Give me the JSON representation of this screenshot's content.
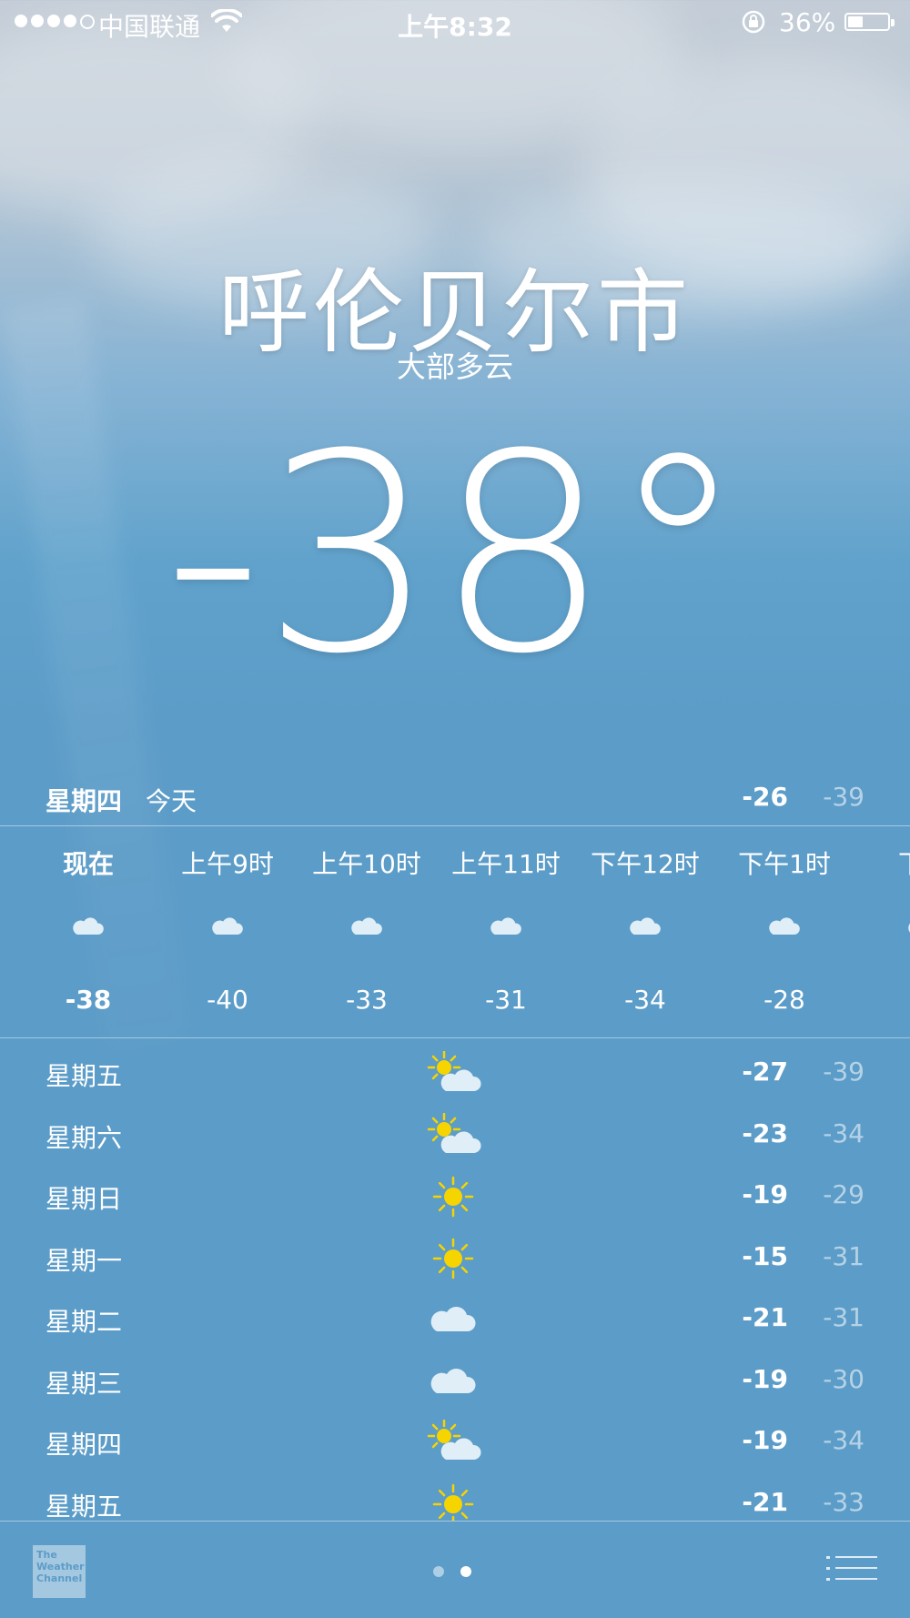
{
  "status_bar": {
    "carrier": "中国联通",
    "time": "上午8:32",
    "battery_percent": "36%",
    "battery_level": 0.36,
    "signal_bars_filled": 4,
    "signal_bars_total": 5
  },
  "weather": {
    "city": "呼伦贝尔市",
    "condition": "大部多云",
    "temperature": "-38°"
  },
  "today": {
    "day": "星期四",
    "label": "今天",
    "high": "-26",
    "low": "-39"
  },
  "hourly": [
    {
      "time": "现在",
      "icon": "cloud-icon",
      "temp": "-38"
    },
    {
      "time": "上午9时",
      "icon": "cloud-icon",
      "temp": "-40"
    },
    {
      "time": "上午10时",
      "icon": "cloud-icon",
      "temp": "-33"
    },
    {
      "time": "上午11时",
      "icon": "cloud-icon",
      "temp": "-31"
    },
    {
      "time": "下午12时",
      "icon": "cloud-icon",
      "temp": "-34"
    },
    {
      "time": "下午1时",
      "icon": "cloud-icon",
      "temp": "-28"
    },
    {
      "time": "下午",
      "icon": "cloud-icon",
      "temp": ""
    }
  ],
  "daily": [
    {
      "day": "星期五",
      "icon": "partly-cloudy-icon",
      "high": "-27",
      "low": "-39"
    },
    {
      "day": "星期六",
      "icon": "partly-cloudy-icon",
      "high": "-23",
      "low": "-34"
    },
    {
      "day": "星期日",
      "icon": "sun-icon",
      "high": "-19",
      "low": "-29"
    },
    {
      "day": "星期一",
      "icon": "sun-icon",
      "high": "-15",
      "low": "-31"
    },
    {
      "day": "星期二",
      "icon": "cloud-icon",
      "high": "-21",
      "low": "-31"
    },
    {
      "day": "星期三",
      "icon": "cloud-icon",
      "high": "-19",
      "low": "-30"
    },
    {
      "day": "星期四",
      "icon": "partly-cloudy-icon",
      "high": "-19",
      "low": "-34"
    },
    {
      "day": "星期五",
      "icon": "sun-icon",
      "high": "-21",
      "low": "-33"
    }
  ],
  "footer": {
    "logo_text": "The Weather Channel",
    "pages_total": 2,
    "current_page": 2
  },
  "colors": {
    "sun": "#f6d400",
    "cloud": "#dfeef7",
    "background": "#5b9cc8"
  }
}
